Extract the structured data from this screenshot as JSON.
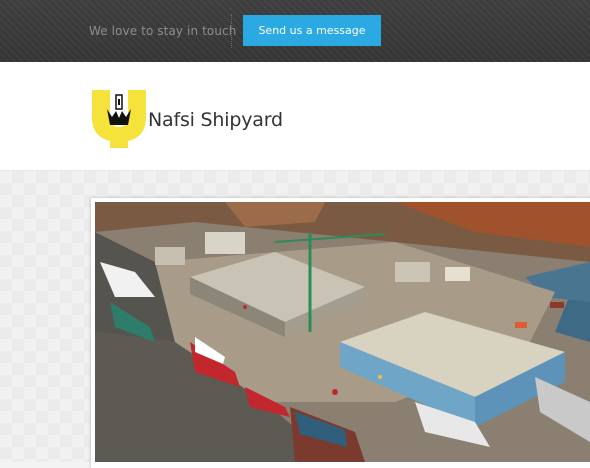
{
  "topbar": {
    "touch_text": "We love to stay in touch",
    "message_button": "Send us a message"
  },
  "header": {
    "brand_name": "Nafsi Shipyard"
  },
  "colors": {
    "topbar": "#3a3a3a",
    "accent": "#2aa9e3",
    "logo_yellow": "#f5e23a"
  },
  "icons": [
    "shipyard-logo-icon"
  ],
  "hero": {
    "image": "aerial-shipyard-photo"
  }
}
